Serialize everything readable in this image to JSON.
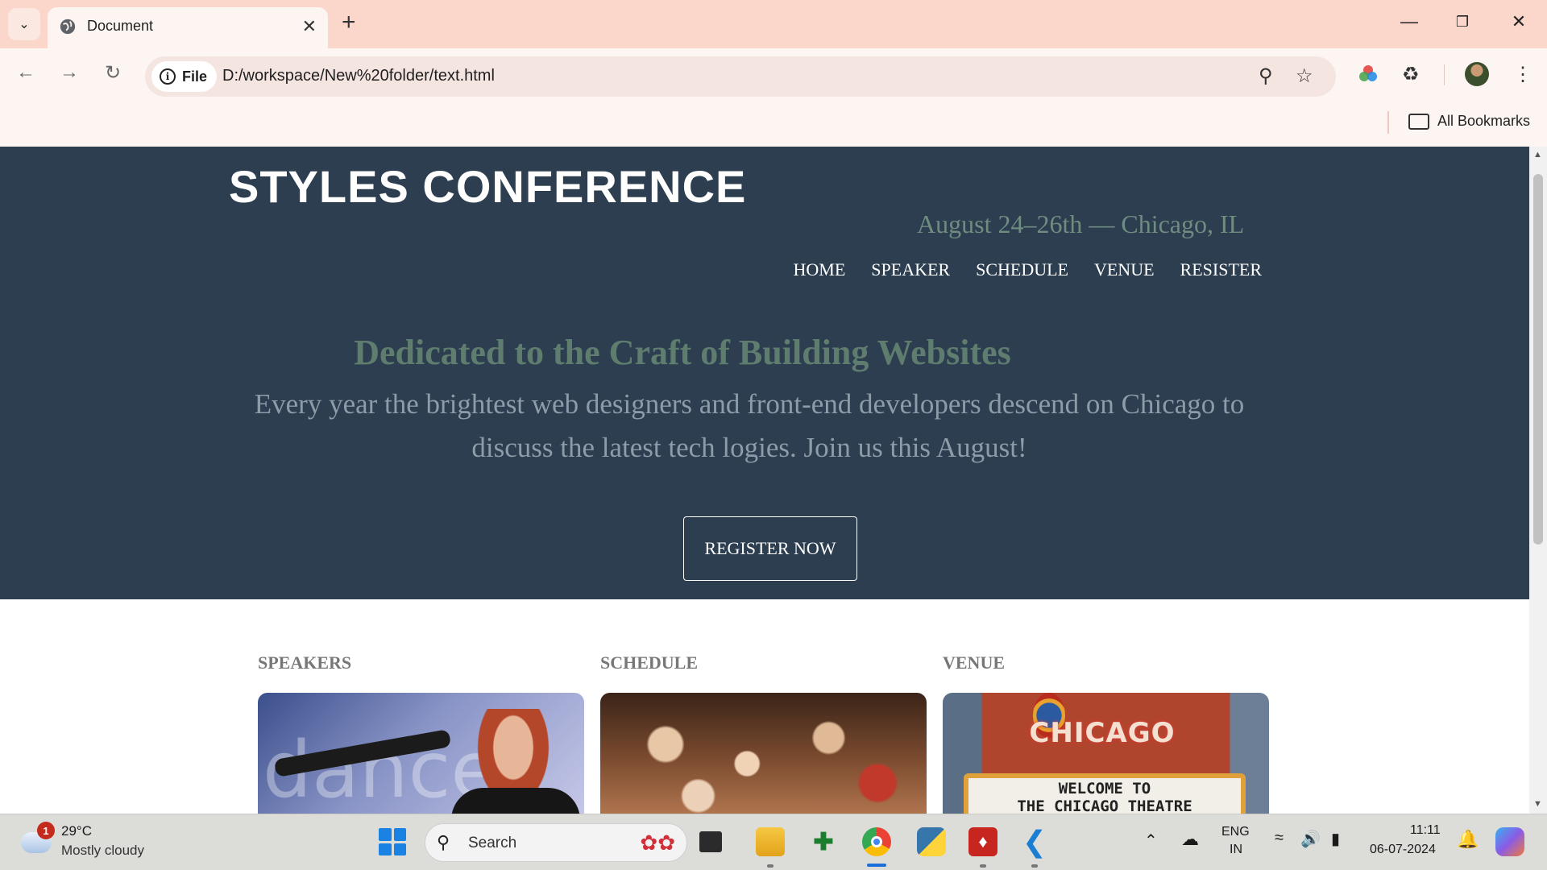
{
  "browser": {
    "tab_title": "Document",
    "file_chip": "File",
    "url": "D:/workspace/New%20folder/text.html",
    "bookmarks_label": "All Bookmarks"
  },
  "site": {
    "logo": "STYLES CONFERENCE",
    "tagline": "August 24–26th — Chicago, IL",
    "nav": [
      "HOME",
      "SPEAKER",
      "SCHEDULE",
      "VENUE",
      "RESISTER"
    ],
    "hero_title": "Dedicated to the Craft of Building Websites",
    "hero_text": "Every year the brightest web designers and front-end developers descend on Chicago to discuss the latest tech logies. Join us this August!",
    "register_button": "REGISTER NOW",
    "sections": [
      "SPEAKERS",
      "SCHEDULE",
      "VENUE"
    ],
    "venue_sign_top": "CHICAGO",
    "venue_sign_line1": "WELCOME  TO",
    "venue_sign_line2": "THE CHICAGO THEATRE",
    "speaker_slide_text": "dance"
  },
  "colors": {
    "hero_bg": "#2c3e50",
    "accent_green": "#5e7d6e",
    "tab_bar": "#fbd7cb"
  },
  "taskbar": {
    "weather_temp": "29°C",
    "weather_cond": "Mostly cloudy",
    "weather_badge": "1",
    "search_placeholder": "Search",
    "lang_top": "ENG",
    "lang_bottom": "IN",
    "time": "11:11",
    "date": "06-07-2024"
  }
}
